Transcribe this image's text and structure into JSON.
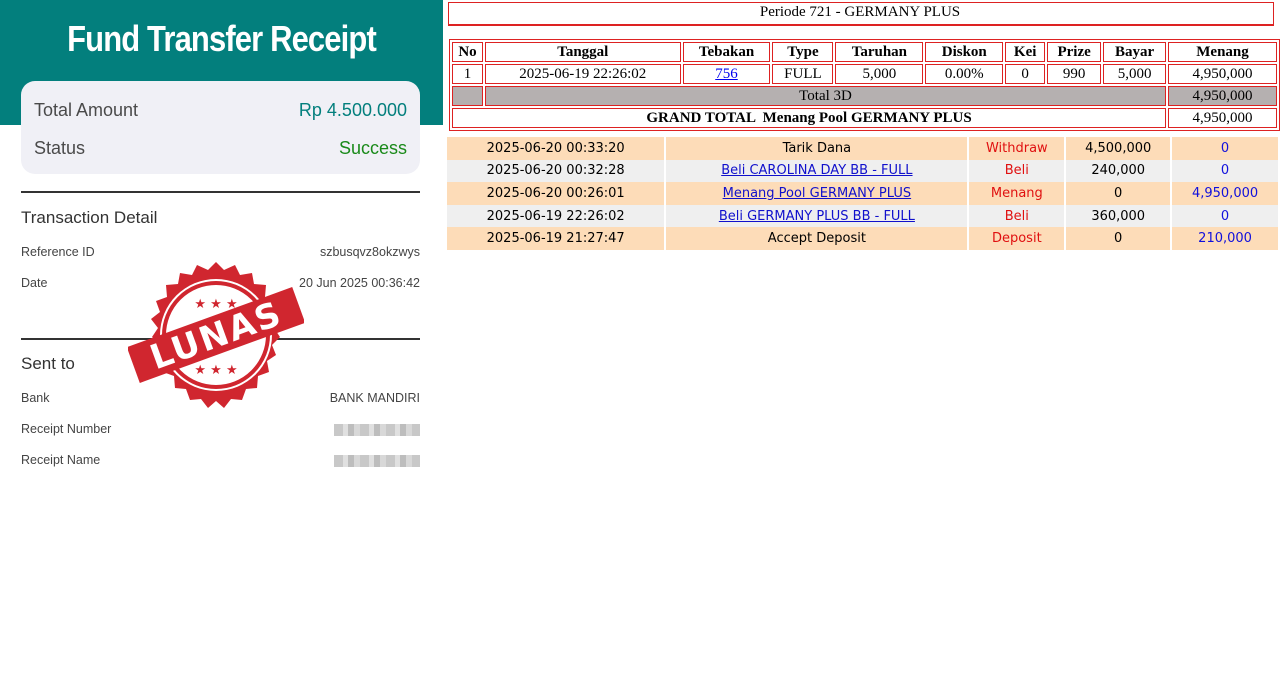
{
  "receipt": {
    "title": "Fund Transfer Receipt",
    "total_amount_label": "Total Amount",
    "total_amount_value": "Rp 4.500.000",
    "status_label": "Status",
    "status_value": "Success",
    "transaction_detail_title": "Transaction Detail",
    "reference_id_label": "Reference ID",
    "reference_id_value": "szbusqvz8okzwys",
    "date_label": "Date",
    "date_value": "20 Jun 2025 00:36:42",
    "sent_to_title": "Sent to",
    "bank_label": "Bank",
    "bank_value": "BANK MANDIRI",
    "receipt_number_label": "Receipt Number",
    "receipt_name_label": "Receipt Name",
    "stamp_text": "LUNAS",
    "colors": {
      "header": "#037f7d",
      "amount": "#037f7d",
      "success": "#1a8a1a",
      "stamp": "#d0262f"
    }
  },
  "periode": {
    "title": "Periode 721 - GERMANY PLUS"
  },
  "bet_table": {
    "headers": [
      "No",
      "Tanggal",
      "Tebakan",
      "Type",
      "Taruhan",
      "Diskon",
      "Kei",
      "Prize",
      "Bayar",
      "Menang"
    ],
    "rows": [
      {
        "no": "1",
        "tanggal": "2025-06-19 22:26:02",
        "tebakan": "756",
        "type": "FULL",
        "taruhan": "5,000",
        "diskon": "0.00%",
        "kei": "0",
        "prize": "990",
        "bayar": "5,000",
        "menang": "4,950,000"
      }
    ],
    "total_label": "Total 3D",
    "total_value": "4,950,000",
    "grand_total_label": "GRAND TOTAL  Menang Pool GERMANY PLUS",
    "grand_total_value": "4,950,000"
  },
  "transactions": [
    {
      "date": "2025-06-20 00:33:20",
      "desc": "Tarik Dana",
      "link": false,
      "type": "Withdraw",
      "amount": "4,500,000",
      "win": "0"
    },
    {
      "date": "2025-06-20 00:32:28",
      "desc": "Beli CAROLINA DAY BB - FULL",
      "link": true,
      "type": "Beli",
      "amount": "240,000",
      "win": "0"
    },
    {
      "date": "2025-06-20 00:26:01",
      "desc": "Menang Pool GERMANY PLUS",
      "link": true,
      "type": "Menang",
      "amount": "0",
      "win": "4,950,000"
    },
    {
      "date": "2025-06-19 22:26:02",
      "desc": "Beli GERMANY PLUS BB - FULL",
      "link": true,
      "type": "Beli",
      "amount": "360,000",
      "win": "0"
    },
    {
      "date": "2025-06-19 21:27:47",
      "desc": "Accept Deposit",
      "link": false,
      "type": "Deposit",
      "amount": "0",
      "win": "210,000"
    }
  ]
}
